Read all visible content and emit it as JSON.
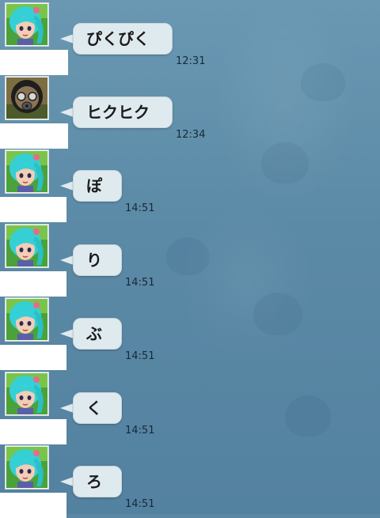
{
  "messages": [
    {
      "sender": "girl-avatar",
      "text": "ぴくぴく",
      "time": "12:31"
    },
    {
      "sender": "masked-avatar",
      "text": "ヒクヒク",
      "time": "12:34"
    },
    {
      "sender": "girl-avatar",
      "text": "ぽ",
      "time": "14:51"
    },
    {
      "sender": "girl-avatar",
      "text": "り",
      "time": "14:51"
    },
    {
      "sender": "girl-avatar",
      "text": "ぶ",
      "time": "14:51"
    },
    {
      "sender": "girl-avatar",
      "text": "く",
      "time": "14:51"
    },
    {
      "sender": "girl-avatar",
      "text": "ろ",
      "time": "14:51"
    }
  ],
  "colors": {
    "background": "#5b8aa6",
    "bubble": "#dfeaef",
    "name_box": "#ffffff",
    "hair": "#35d0d6"
  }
}
